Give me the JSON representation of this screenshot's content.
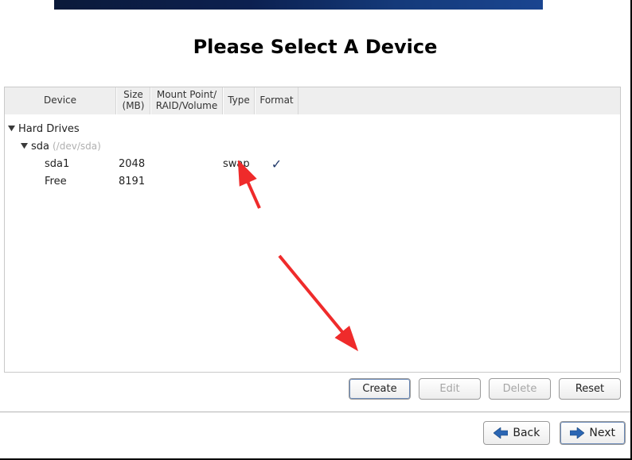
{
  "title": "Please Select A Device",
  "columns": {
    "device": "Device",
    "size_l1": "Size",
    "size_l2": "(MB)",
    "mount_l1": "Mount Point/",
    "mount_l2": "RAID/Volume",
    "type": "Type",
    "format": "Format"
  },
  "tree": {
    "root_label": "Hard Drives",
    "disk": {
      "name": "sda",
      "path": "(/dev/sda)"
    },
    "rows": [
      {
        "device": "sda1",
        "size": "2048",
        "mount": "",
        "type": "swap",
        "format": "✓"
      },
      {
        "device": "Free",
        "size": "8191",
        "mount": "",
        "type": "",
        "format": ""
      }
    ]
  },
  "buttons": {
    "create": "Create",
    "edit": "Edit",
    "delete": "Delete",
    "reset": "Reset",
    "back": "Back",
    "next": "Next"
  }
}
